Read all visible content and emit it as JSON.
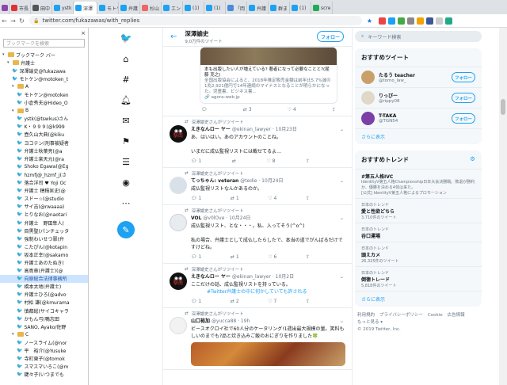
{
  "tabs": [
    {
      "label": "市長",
      "color": "#d33"
    },
    {
      "label": "田中",
      "color": "#555"
    },
    {
      "label": "ystk",
      "color": "#1da1f2"
    },
    {
      "label": "深澤",
      "color": "#1da1f2",
      "active": true
    },
    {
      "label": "モトケ",
      "color": "#1da1f2"
    },
    {
      "label": "弁護",
      "color": "#1da1f2"
    },
    {
      "label": "杉山",
      "color": "#e66"
    },
    {
      "label": "エン",
      "color": "#1da1f2"
    },
    {
      "label": "(1)",
      "color": "#1da1f2"
    },
    {
      "label": "(1)",
      "color": "#1da1f2"
    },
    {
      "label": "「岡",
      "color": "#4b89dc"
    },
    {
      "label": "弁護",
      "color": "#1da1f2"
    },
    {
      "label": "群ま",
      "color": "#1da1f2"
    },
    {
      "label": "(1)",
      "color": "#1da1f2"
    },
    {
      "label": "scre",
      "color": "#2a5"
    }
  ],
  "address": {
    "url": "twitter.com/fukazawas/with_replies"
  },
  "sidebar": {
    "search_placeholder": "ブックマークを検索",
    "items": [
      {
        "label": "ブックマーク バー",
        "type": "folder",
        "depth": 0
      },
      {
        "label": "弁護士",
        "type": "folder",
        "depth": 1
      },
      {
        "label": "深澤諭史@fukazawa",
        "type": "tw",
        "depth": 2
      },
      {
        "label": "モトケン@motoken_t",
        "type": "tw",
        "depth": 2
      },
      {
        "label": "A",
        "type": "folder",
        "depth": 2
      },
      {
        "label": "モトケン@motoken",
        "type": "tw",
        "depth": 3
      },
      {
        "label": "小倉秀夫@Hideo_O",
        "type": "tw",
        "depth": 3
      },
      {
        "label": "B",
        "type": "folder",
        "depth": 2
      },
      {
        "label": "ystk(@tswkus)さん",
        "type": "tw",
        "depth": 3
      },
      {
        "label": "K・９９９(@k999",
        "type": "tw",
        "depth": 3
      },
      {
        "label": "壺久山大典(@kiku",
        "type": "tw",
        "depth": 3
      },
      {
        "label": "ヨコテン(刑事被疑者",
        "type": "tw",
        "depth": 3
      },
      {
        "label": "弁護士秋葉亮(@a",
        "type": "tw",
        "depth": 3
      },
      {
        "label": "弁護士楽天元(@ra",
        "type": "tw",
        "depth": 3
      },
      {
        "label": "Shoko Egawa(@Eg",
        "type": "tw",
        "depth": 3
      },
      {
        "label": "hzmfj@_hzmf_j(さ",
        "type": "tw",
        "depth": 3
      },
      {
        "label": "落合洋司 ♥ Yoji Oc",
        "type": "tw",
        "depth": 3
      },
      {
        "label": "弁護士 穂積匡史(@",
        "type": "tw",
        "depth": 3
      },
      {
        "label": "スドー☆(@studio",
        "type": "tw",
        "depth": 3
      },
      {
        "label": "サイ吉(@rwaaaa)",
        "type": "tw",
        "depth": 3
      },
      {
        "label": "とりなお(@naotari",
        "type": "tw",
        "depth": 3
      },
      {
        "label": "弁護士　野田隼人(",
        "type": "tw",
        "depth": 3
      },
      {
        "label": "目黒聖(パンチェッタ",
        "type": "tw",
        "depth": 3
      },
      {
        "label": "強制わいせつ罪(弁",
        "type": "tw",
        "depth": 3
      },
      {
        "label": "こたぴん(@kotapin",
        "type": "tw",
        "depth": 3
      },
      {
        "label": "坂本正幸(@sakamo",
        "type": "tw",
        "depth": 3
      },
      {
        "label": "弁護士あのたぬき(",
        "type": "tw",
        "depth": 3
      },
      {
        "label": "高島章(弁護士)(@",
        "type": "tw",
        "depth": 3
      },
      {
        "label": "向原総合法律事務所",
        "type": "tw",
        "depth": 3,
        "selected": true
      },
      {
        "label": "橋本太地(弁護士)",
        "type": "tw",
        "depth": 3
      },
      {
        "label": "弁護士ひろ(@advo",
        "type": "tw",
        "depth": 3
      },
      {
        "label": "村松 謙(@kmurama",
        "type": "tw",
        "depth": 3
      },
      {
        "label": "慎都総(サイコキャラ",
        "type": "tw",
        "depth": 3
      },
      {
        "label": "かもん弓(鴨志田",
        "type": "tw",
        "depth": 3
      },
      {
        "label": "SANO, Ayako/佐野",
        "type": "tw",
        "depth": 3
      },
      {
        "label": "C",
        "type": "folder",
        "depth": 2
      },
      {
        "label": "ノースライム(@nor",
        "type": "tw",
        "depth": 3
      },
      {
        "label": "平　裕介(@Yusuke",
        "type": "tw",
        "depth": 3
      },
      {
        "label": "寺町東子(@tomok",
        "type": "tw",
        "depth": 3
      },
      {
        "label": "スマスマいろこ(@m",
        "type": "tw",
        "depth": 3
      },
      {
        "label": "鍵々子(いつまでも",
        "type": "tw",
        "depth": 3
      }
    ]
  },
  "profile": {
    "name": "深澤諭史",
    "count": "9,0万件のツイート",
    "follow": "フォロー"
  },
  "card": {
    "text": "本も出版したい人が増えている? 著者になって必要なことと?(尾藤 克之)",
    "desc": "全国出版協会によると、2018年推定販売金額は前年比5.7%減の1兆2,921億円で14年連続のマイナスとなることが明らかになった。児童書、ビジネス書...",
    "link": "agora-web.jp",
    "retweets": "3",
    "likes": "4"
  },
  "tweets": [
    {
      "rt": "深澤諭史さんがリツイート",
      "name": "えきなんロー ヤー",
      "handle": "@ekinan_lawyer · 10月23日",
      "text": "あ、はいはい。あのアカウントのことね。\n\nいまだに成仏監視リストには載せてるよ…",
      "replies": "1",
      "retweets": "",
      "likes": "8",
      "avatar": "nikoku"
    },
    {
      "rt": "深澤諭史さんがリツイート",
      "name": "てっちゃん: veteran",
      "handle": "@tedie · 10月24日",
      "text": "成仏監視リストなんかあるのか。",
      "replies": "1",
      "retweets": "1",
      "likes": "4",
      "avatar": "teddie"
    },
    {
      "rt": "深澤諭史さんがリツイート",
      "name": "VOL",
      "handle": "@v0lOve · 10月24日",
      "text": "成仏監視リスト、とな・・・。私、入ってそう(^o^)\n\n私の場合、弁護士として成仏したらしたで、本当の道でがんばるだけですけどね。",
      "replies": "1",
      "retweets": "1",
      "likes": "6",
      "avatar": "vol"
    },
    {
      "rt": "深澤諭史さんがリツイート",
      "name": "えきなんロー ヤー",
      "handle": "@ekinan_lawyer · 10月2日",
      "text": "ここだけの話、成仏監視リストを持っている。",
      "hashtag": "#Twitter弁護士の中に何かしていても許される",
      "replies": "1",
      "retweets": "2",
      "likes": "7",
      "avatar": "nikoku"
    },
    {
      "rt": "深澤諭史さんがリツイート",
      "name": "山口裕加",
      "handle": "@yucca88 · 19h",
      "text": "ビースオクロイ社で60人分のケータリング!1週出最大規模の量。笑料もしいのまでも?品と炊き込みご飯のおにぎりを作りました🍀",
      "replies": "",
      "retweets": "",
      "likes": "",
      "avatar": "yucca"
    }
  ],
  "right": {
    "search_placeholder": "キーワード検索",
    "suggest_title": "おすすめツイート",
    "suggestions": [
      {
        "name": "たるう teacher",
        "handle": "@tomo_law_",
        "color": "#c9a06a"
      },
      {
        "name": "りっぴー",
        "handle": "@rippy08",
        "color": "#e0d8c8"
      },
      {
        "name": "T-TAKA",
        "handle": "@TGN54",
        "color": "#7b3fa8"
      }
    ],
    "follow": "フォロー",
    "more": "さらに表示",
    "trend_title": "おすすめトレンド",
    "trends": [
      {
        "title": "#第五人格IVC",
        "desc": "IdentityV第五人格Championship日本大会決勝戦。敗退が勝利か、優勝を決める4体は来た。",
        "meta": "[公式] IdentityV第五人格によるプロモーション"
      },
      {
        "title": "愛と性欲どちら",
        "desc": "日本のトレンド",
        "meta": "3,710件のツイート"
      },
      {
        "title": "谷口運場",
        "desc": "日本のトレンド",
        "meta": ""
      },
      {
        "title": "頭えカメ",
        "desc": "日本のトレンド",
        "meta": "26,325件のツイート"
      },
      {
        "title": "倒徳トレード",
        "desc": "日本のトレンド",
        "meta": "5,818件のツイート"
      }
    ],
    "more2": "さらに表示",
    "footer": [
      "利用規約",
      "プライバシーポリシー",
      "Cookie",
      "広告情報",
      "もっと見る ▾",
      "© 2019 Twitter, Inc."
    ]
  }
}
